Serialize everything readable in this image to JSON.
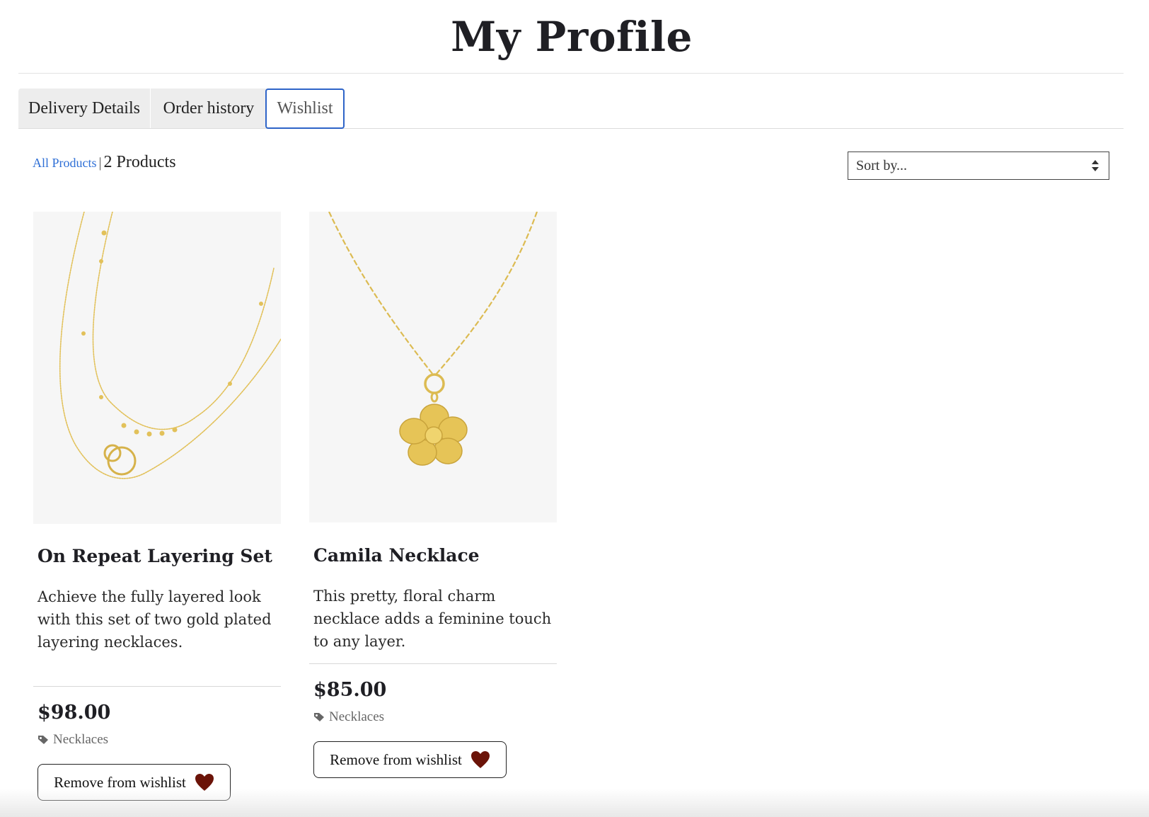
{
  "page": {
    "title": "My Profile"
  },
  "tabs": [
    {
      "label": "Delivery Details",
      "active": false
    },
    {
      "label": "Order history",
      "active": false
    },
    {
      "label": "Wishlist",
      "active": true
    }
  ],
  "listing": {
    "all_products_link": "All Products",
    "separator": "|",
    "count_text": "2 Products",
    "sort": {
      "selected": "Sort by..."
    }
  },
  "products": [
    {
      "name": "On Repeat Layering Set",
      "description": "Achieve the fully layered look with this set of two gold plated layering necklaces.",
      "price": "$98.00",
      "category": "Necklaces",
      "remove_label": "Remove from wishlist"
    },
    {
      "name": "Camila Necklace",
      "description": "This pretty, floral charm necklace adds a feminine touch to any layer.",
      "price": "$85.00",
      "category": "Necklaces",
      "remove_label": "Remove from wishlist"
    }
  ],
  "colors": {
    "accent_link": "#2e6fd6",
    "active_tab_border": "#2e64c8",
    "heart": "#6b1308",
    "gold": "#e2c15a"
  },
  "icons": {
    "tag": "tag-icon",
    "heart": "heart-icon",
    "sort": "sort-arrows-icon"
  }
}
